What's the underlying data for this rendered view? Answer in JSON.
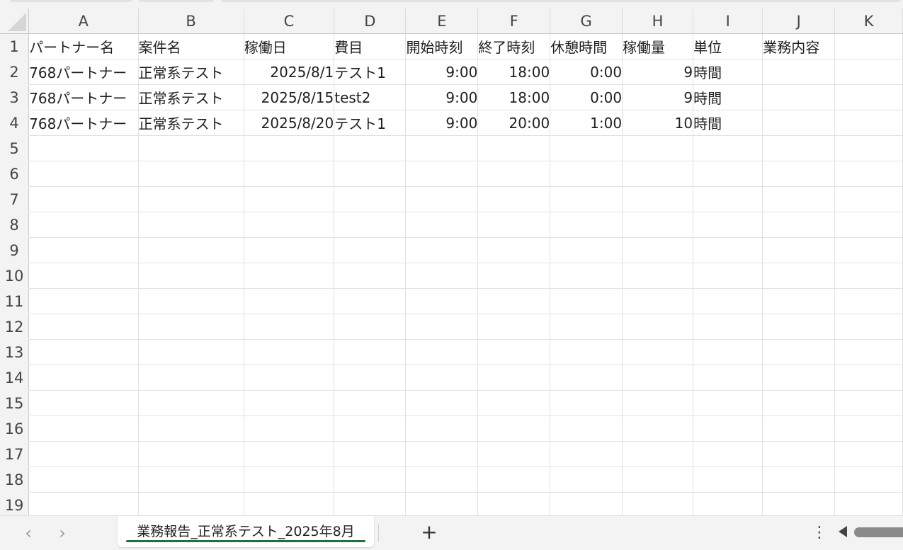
{
  "columns": [
    "A",
    "B",
    "C",
    "D",
    "E",
    "F",
    "G",
    "H",
    "I",
    "J",
    "K"
  ],
  "rows": [
    {
      "num": "1",
      "cells": [
        "パートナー名",
        "案件名",
        "稼働日",
        "費目",
        "開始時刻",
        "終了時刻",
        "休憩時間",
        "稼働量",
        "単位",
        "業務内容",
        ""
      ]
    },
    {
      "num": "2",
      "cells": [
        "768パートナー",
        "正常系テスト",
        "2025/8/1",
        "テスト1",
        "9:00",
        "18:00",
        "0:00",
        "9",
        "時間",
        "",
        ""
      ]
    },
    {
      "num": "3",
      "cells": [
        "768パートナー",
        "正常系テスト",
        "2025/8/15",
        "test2",
        "9:00",
        "18:00",
        "0:00",
        "9",
        "時間",
        "",
        ""
      ]
    },
    {
      "num": "4",
      "cells": [
        "768パートナー",
        "正常系テスト",
        "2025/8/20",
        "テスト1",
        "9:00",
        "20:00",
        "1:00",
        "10",
        "時間",
        "",
        ""
      ]
    },
    {
      "num": "5",
      "cells": [
        "",
        "",
        "",
        "",
        "",
        "",
        "",
        "",
        "",
        "",
        ""
      ]
    },
    {
      "num": "6",
      "cells": [
        "",
        "",
        "",
        "",
        "",
        "",
        "",
        "",
        "",
        "",
        ""
      ]
    },
    {
      "num": "7",
      "cells": [
        "",
        "",
        "",
        "",
        "",
        "",
        "",
        "",
        "",
        "",
        ""
      ]
    },
    {
      "num": "8",
      "cells": [
        "",
        "",
        "",
        "",
        "",
        "",
        "",
        "",
        "",
        "",
        ""
      ]
    },
    {
      "num": "9",
      "cells": [
        "",
        "",
        "",
        "",
        "",
        "",
        "",
        "",
        "",
        "",
        ""
      ]
    },
    {
      "num": "10",
      "cells": [
        "",
        "",
        "",
        "",
        "",
        "",
        "",
        "",
        "",
        "",
        ""
      ]
    },
    {
      "num": "11",
      "cells": [
        "",
        "",
        "",
        "",
        "",
        "",
        "",
        "",
        "",
        "",
        ""
      ]
    },
    {
      "num": "12",
      "cells": [
        "",
        "",
        "",
        "",
        "",
        "",
        "",
        "",
        "",
        "",
        ""
      ]
    },
    {
      "num": "13",
      "cells": [
        "",
        "",
        "",
        "",
        "",
        "",
        "",
        "",
        "",
        "",
        ""
      ]
    },
    {
      "num": "14",
      "cells": [
        "",
        "",
        "",
        "",
        "",
        "",
        "",
        "",
        "",
        "",
        ""
      ]
    },
    {
      "num": "15",
      "cells": [
        "",
        "",
        "",
        "",
        "",
        "",
        "",
        "",
        "",
        "",
        ""
      ]
    },
    {
      "num": "16",
      "cells": [
        "",
        "",
        "",
        "",
        "",
        "",
        "",
        "",
        "",
        "",
        ""
      ]
    },
    {
      "num": "17",
      "cells": [
        "",
        "",
        "",
        "",
        "",
        "",
        "",
        "",
        "",
        "",
        ""
      ]
    },
    {
      "num": "18",
      "cells": [
        "",
        "",
        "",
        "",
        "",
        "",
        "",
        "",
        "",
        "",
        ""
      ]
    },
    {
      "num": "19",
      "cells": [
        "",
        "",
        "",
        "",
        "",
        "",
        "",
        "",
        "",
        "",
        ""
      ]
    }
  ],
  "sheet_tab": {
    "label": "業務報告_正常系テスト_2025年8月"
  },
  "bottom": {
    "prev_icon": "chevron-left-icon",
    "next_icon": "chevron-right-icon",
    "add_label": "+",
    "more_label": "⋮"
  },
  "colors": {
    "accent": "#1e7145"
  }
}
